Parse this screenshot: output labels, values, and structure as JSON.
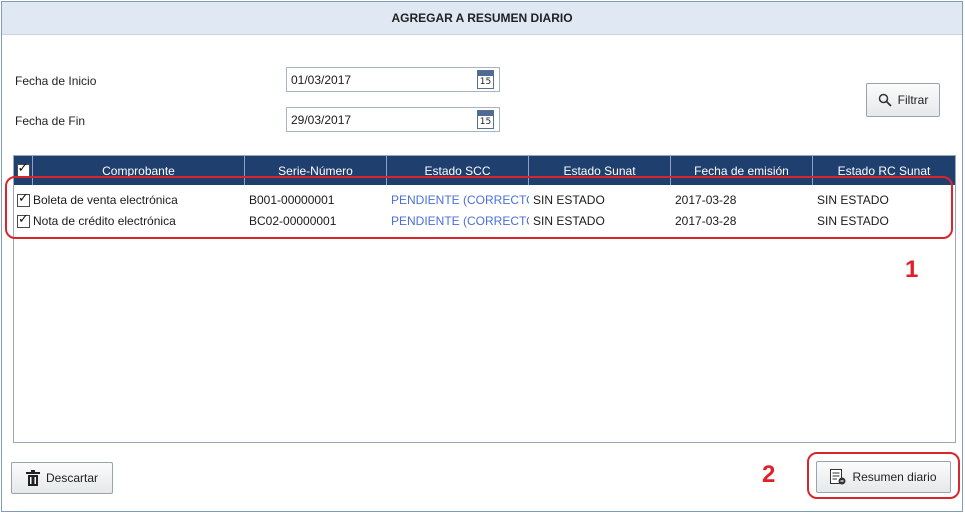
{
  "window": {
    "title": "AGREGAR A RESUMEN DIARIO"
  },
  "filters": {
    "start_label": "Fecha de Inicio",
    "start_value": "01/03/2017",
    "end_label": "Fecha de Fin",
    "end_value": "29/03/2017",
    "calendar_day": "15",
    "filter_button": "Filtrar"
  },
  "grid": {
    "columns": [
      "Comprobante",
      "Serie-Número",
      "Estado SCC",
      "Estado Sunat",
      "Fecha de emisión",
      "Estado RC Sunat"
    ],
    "rows": [
      {
        "comprobante": "Boleta de venta electrónica",
        "serie": "B001-00000001",
        "estado_scc": "PENDIENTE (CORRECTO)",
        "estado_sunat": "SIN ESTADO",
        "fecha": "2017-03-28",
        "estado_rc": "SIN ESTADO",
        "checked": true
      },
      {
        "comprobante": "Nota de crédito electrónica",
        "serie": "BC02-00000001",
        "estado_scc": "PENDIENTE (CORRECTO)",
        "estado_sunat": "SIN ESTADO",
        "fecha": "2017-03-28",
        "estado_rc": "SIN ESTADO",
        "checked": true
      }
    ]
  },
  "footer": {
    "discard_button": "Descartar",
    "summary_button": "Resumen diario"
  },
  "annotations": {
    "marker_1": "1",
    "marker_2": "2"
  },
  "colors": {
    "header_bg": "#1f3f6e",
    "status_blue": "#4a6fd8",
    "annotation_red": "#d9262c"
  }
}
